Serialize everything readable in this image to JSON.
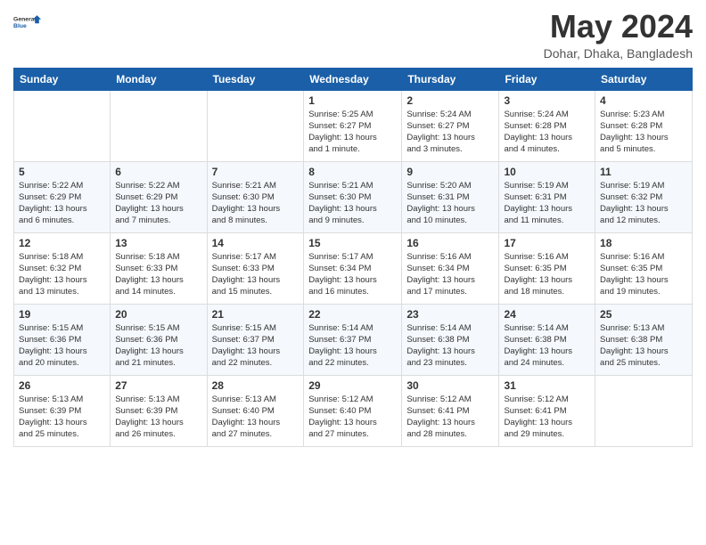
{
  "header": {
    "logo_line1": "General",
    "logo_line2": "Blue",
    "month": "May 2024",
    "location": "Dohar, Dhaka, Bangladesh"
  },
  "weekdays": [
    "Sunday",
    "Monday",
    "Tuesday",
    "Wednesday",
    "Thursday",
    "Friday",
    "Saturday"
  ],
  "weeks": [
    [
      {
        "day": "",
        "info": ""
      },
      {
        "day": "",
        "info": ""
      },
      {
        "day": "",
        "info": ""
      },
      {
        "day": "1",
        "info": "Sunrise: 5:25 AM\nSunset: 6:27 PM\nDaylight: 13 hours\nand 1 minute."
      },
      {
        "day": "2",
        "info": "Sunrise: 5:24 AM\nSunset: 6:27 PM\nDaylight: 13 hours\nand 3 minutes."
      },
      {
        "day": "3",
        "info": "Sunrise: 5:24 AM\nSunset: 6:28 PM\nDaylight: 13 hours\nand 4 minutes."
      },
      {
        "day": "4",
        "info": "Sunrise: 5:23 AM\nSunset: 6:28 PM\nDaylight: 13 hours\nand 5 minutes."
      }
    ],
    [
      {
        "day": "5",
        "info": "Sunrise: 5:22 AM\nSunset: 6:29 PM\nDaylight: 13 hours\nand 6 minutes."
      },
      {
        "day": "6",
        "info": "Sunrise: 5:22 AM\nSunset: 6:29 PM\nDaylight: 13 hours\nand 7 minutes."
      },
      {
        "day": "7",
        "info": "Sunrise: 5:21 AM\nSunset: 6:30 PM\nDaylight: 13 hours\nand 8 minutes."
      },
      {
        "day": "8",
        "info": "Sunrise: 5:21 AM\nSunset: 6:30 PM\nDaylight: 13 hours\nand 9 minutes."
      },
      {
        "day": "9",
        "info": "Sunrise: 5:20 AM\nSunset: 6:31 PM\nDaylight: 13 hours\nand 10 minutes."
      },
      {
        "day": "10",
        "info": "Sunrise: 5:19 AM\nSunset: 6:31 PM\nDaylight: 13 hours\nand 11 minutes."
      },
      {
        "day": "11",
        "info": "Sunrise: 5:19 AM\nSunset: 6:32 PM\nDaylight: 13 hours\nand 12 minutes."
      }
    ],
    [
      {
        "day": "12",
        "info": "Sunrise: 5:18 AM\nSunset: 6:32 PM\nDaylight: 13 hours\nand 13 minutes."
      },
      {
        "day": "13",
        "info": "Sunrise: 5:18 AM\nSunset: 6:33 PM\nDaylight: 13 hours\nand 14 minutes."
      },
      {
        "day": "14",
        "info": "Sunrise: 5:17 AM\nSunset: 6:33 PM\nDaylight: 13 hours\nand 15 minutes."
      },
      {
        "day": "15",
        "info": "Sunrise: 5:17 AM\nSunset: 6:34 PM\nDaylight: 13 hours\nand 16 minutes."
      },
      {
        "day": "16",
        "info": "Sunrise: 5:16 AM\nSunset: 6:34 PM\nDaylight: 13 hours\nand 17 minutes."
      },
      {
        "day": "17",
        "info": "Sunrise: 5:16 AM\nSunset: 6:35 PM\nDaylight: 13 hours\nand 18 minutes."
      },
      {
        "day": "18",
        "info": "Sunrise: 5:16 AM\nSunset: 6:35 PM\nDaylight: 13 hours\nand 19 minutes."
      }
    ],
    [
      {
        "day": "19",
        "info": "Sunrise: 5:15 AM\nSunset: 6:36 PM\nDaylight: 13 hours\nand 20 minutes."
      },
      {
        "day": "20",
        "info": "Sunrise: 5:15 AM\nSunset: 6:36 PM\nDaylight: 13 hours\nand 21 minutes."
      },
      {
        "day": "21",
        "info": "Sunrise: 5:15 AM\nSunset: 6:37 PM\nDaylight: 13 hours\nand 22 minutes."
      },
      {
        "day": "22",
        "info": "Sunrise: 5:14 AM\nSunset: 6:37 PM\nDaylight: 13 hours\nand 22 minutes."
      },
      {
        "day": "23",
        "info": "Sunrise: 5:14 AM\nSunset: 6:38 PM\nDaylight: 13 hours\nand 23 minutes."
      },
      {
        "day": "24",
        "info": "Sunrise: 5:14 AM\nSunset: 6:38 PM\nDaylight: 13 hours\nand 24 minutes."
      },
      {
        "day": "25",
        "info": "Sunrise: 5:13 AM\nSunset: 6:38 PM\nDaylight: 13 hours\nand 25 minutes."
      }
    ],
    [
      {
        "day": "26",
        "info": "Sunrise: 5:13 AM\nSunset: 6:39 PM\nDaylight: 13 hours\nand 25 minutes."
      },
      {
        "day": "27",
        "info": "Sunrise: 5:13 AM\nSunset: 6:39 PM\nDaylight: 13 hours\nand 26 minutes."
      },
      {
        "day": "28",
        "info": "Sunrise: 5:13 AM\nSunset: 6:40 PM\nDaylight: 13 hours\nand 27 minutes."
      },
      {
        "day": "29",
        "info": "Sunrise: 5:12 AM\nSunset: 6:40 PM\nDaylight: 13 hours\nand 27 minutes."
      },
      {
        "day": "30",
        "info": "Sunrise: 5:12 AM\nSunset: 6:41 PM\nDaylight: 13 hours\nand 28 minutes."
      },
      {
        "day": "31",
        "info": "Sunrise: 5:12 AM\nSunset: 6:41 PM\nDaylight: 13 hours\nand 29 minutes."
      },
      {
        "day": "",
        "info": ""
      }
    ]
  ]
}
